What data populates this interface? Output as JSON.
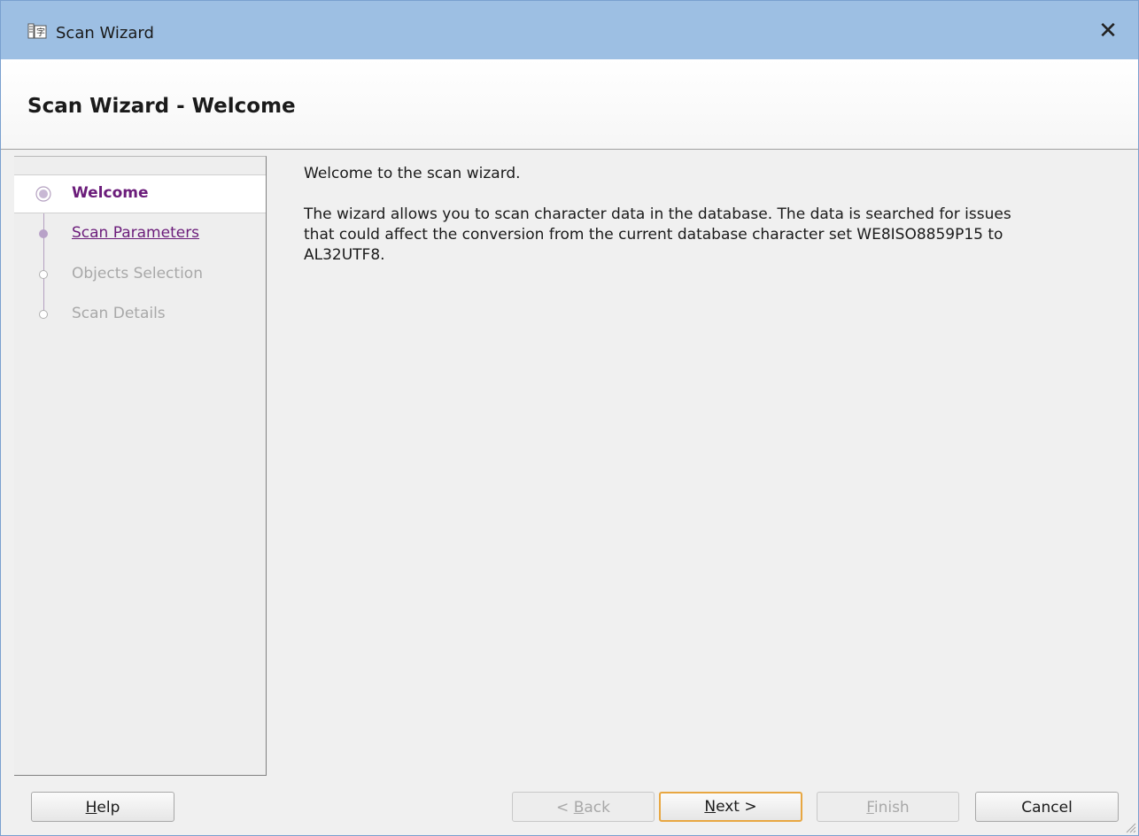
{
  "window": {
    "title": "Scan Wizard",
    "close_glyph": "✕"
  },
  "header": {
    "title": "Scan Wizard - Welcome"
  },
  "steps": [
    {
      "label": "Welcome",
      "state": "current"
    },
    {
      "label": "Scan Parameters",
      "state": "link"
    },
    {
      "label": "Objects Selection",
      "state": "disabled"
    },
    {
      "label": "Scan Details",
      "state": "disabled"
    }
  ],
  "content": {
    "intro": "Welcome to the scan wizard.",
    "description_lines": [
      "The wizard allows you to scan character data in the database. The data is searched for issues",
      "that could affect the conversion from the current database character set WE8ISO8859P15 to",
      "AL32UTF8."
    ]
  },
  "buttons": {
    "help": {
      "pre": "",
      "mnemonic": "H",
      "post": "elp"
    },
    "back": {
      "pre": "< ",
      "mnemonic": "B",
      "post": "ack"
    },
    "next": {
      "pre": "",
      "mnemonic": "N",
      "post": "ext >"
    },
    "finish": {
      "pre": "",
      "mnemonic": "F",
      "post": "inish"
    },
    "cancel": {
      "pre": "Cancel",
      "mnemonic": "",
      "post": ""
    }
  },
  "colors": {
    "titlebar": "#9dbfe3",
    "accent_purple": "#6b1c7a",
    "default_button_border": "#e8a742"
  },
  "icons": [
    "wizard-app-icon",
    "close-icon",
    "step-current-icon",
    "step-link-icon",
    "step-disabled-icon",
    "resize-grip-icon"
  ]
}
